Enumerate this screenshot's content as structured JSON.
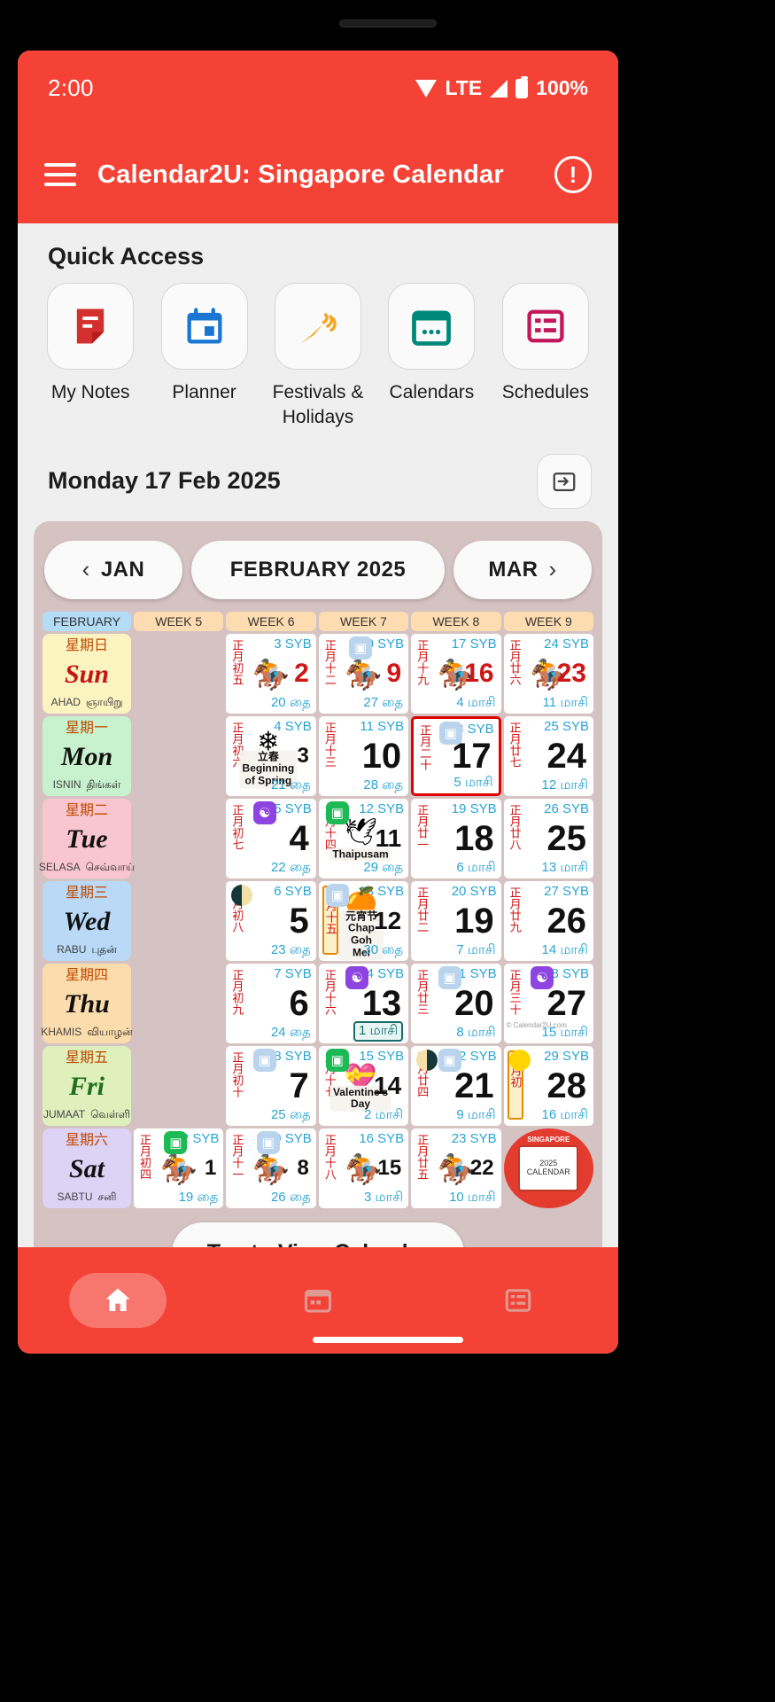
{
  "status": {
    "time": "2:00",
    "network": "LTE",
    "battery": "100%",
    "wifi_icon": "wifi-icon",
    "signal_icon": "signal-icon",
    "battery_icon": "battery-icon"
  },
  "appbar": {
    "menu_icon": "hamburger-menu-icon",
    "title": "Calendar2U: Singapore Calendar",
    "info_icon": "info-icon",
    "info_glyph": "!"
  },
  "quick_access": {
    "title": "Quick Access",
    "items": [
      {
        "label": "My Notes",
        "icon": "notes-icon",
        "glyph": "📝",
        "color": "#d32f2f"
      },
      {
        "label": "Planner",
        "icon": "planner-calendar-icon",
        "glyph": "📅",
        "color": "#1976d2"
      },
      {
        "label": "Festivals & Holidays",
        "icon": "party-popper-icon",
        "glyph": "🎉",
        "color": "#f5a623"
      },
      {
        "label": "Calendars",
        "icon": "calendars-icon",
        "glyph": "🗓",
        "color": "#00897b"
      },
      {
        "label": "Schedules",
        "icon": "schedules-list-icon",
        "glyph": "📋",
        "color": "#c2185b"
      }
    ]
  },
  "dateline": {
    "text": "Monday 17 Feb 2025",
    "jump_icon": "jump-to-date-icon"
  },
  "month_nav": {
    "prev_label": "JAN",
    "prev_icon": "chevron-left-icon",
    "current_label": "FEBRUARY 2025",
    "next_label": "MAR",
    "next_icon": "chevron-right-icon"
  },
  "week_headers": [
    "FEBRUARY",
    "WEEK 5",
    "WEEK 6",
    "WEEK 7",
    "WEEK 8",
    "WEEK 9"
  ],
  "day_rows": [
    {
      "cn": "星期日",
      "en": "Sun",
      "ms": "AHAD",
      "ta": "ஞாயிறு",
      "bg": "#fbf3c0",
      "color": "#c41414"
    },
    {
      "cn": "星期一",
      "en": "Mon",
      "ms": "ISNIN",
      "ta": "திங்கள்",
      "bg": "#c7f2cd",
      "color": "#111111"
    },
    {
      "cn": "星期二",
      "en": "Tue",
      "ms": "SELASA",
      "ta": "செவ்வாய்",
      "bg": "#f9c5d1",
      "color": "#111111"
    },
    {
      "cn": "星期三",
      "en": "Wed",
      "ms": "RABU",
      "ta": "புதன்",
      "bg": "#b9d9f7",
      "color": "#111111"
    },
    {
      "cn": "星期四",
      "en": "Thu",
      "ms": "KHAMIS",
      "ta": "வியாழன்",
      "bg": "#fbdcac",
      "color": "#111111"
    },
    {
      "cn": "星期五",
      "en": "Fri",
      "ms": "JUMAAT",
      "ta": "வெள்ளி",
      "bg": "#dff0bd",
      "color": "#1e6f1e"
    },
    {
      "cn": "星期六",
      "en": "Sat",
      "ms": "SABTU",
      "ta": "சனி",
      "bg": "#ddd3f5",
      "color": "#111111"
    }
  ],
  "cells": {
    "sun": [
      {
        "empty": true
      },
      {
        "syb": "3 SYB",
        "lunar": "正月初五",
        "num": "2",
        "tamil": "20 தை",
        "emoji": "🏇",
        "style": "sun"
      },
      {
        "syb": "10 SYB",
        "lunar": "正月十二",
        "num": "9",
        "tamil": "27 தை",
        "emoji": "🏇",
        "style": "sun",
        "badge": "blue"
      },
      {
        "syb": "17 SYB",
        "lunar": "正月十九",
        "num": "16",
        "tamil": "4 மாசி",
        "emoji": "🏇",
        "style": "sun"
      },
      {
        "syb": "24 SYB",
        "lunar": "正月廿六",
        "num": "23",
        "tamil": "11 மாசி",
        "emoji": "🏇",
        "style": "sun"
      }
    ],
    "mon": [
      {
        "empty": true
      },
      {
        "syb": "4 SYB",
        "lunar": "正月初六",
        "num": "3",
        "tamil": "21 தை",
        "event_emoji": "❄",
        "event_label": "立春\nBeginning of Spring",
        "style": "small"
      },
      {
        "syb": "11 SYB",
        "lunar": "正月十三",
        "num": "10",
        "tamil": "28 தை",
        "style": "big"
      },
      {
        "syb": "18 SYB",
        "lunar": "正月二十",
        "num": "17",
        "tamil": "5 மாசி",
        "style": "big",
        "today": true,
        "badge": "blue"
      },
      {
        "syb": "25 SYB",
        "lunar": "正月廿七",
        "num": "24",
        "tamil": "12 மாசி",
        "style": "big"
      }
    ],
    "tue": [
      {
        "empty": true
      },
      {
        "syb": "5 SYB",
        "lunar": "正月初七",
        "num": "4",
        "tamil": "22 தை",
        "style": "big",
        "badge": "purple"
      },
      {
        "syb": "12 SYB",
        "lunar": "正月十四",
        "num": "11",
        "tamil": "29 தை",
        "event_emoji": "🕊",
        "event_label": "Thaipusam",
        "style": "mid",
        "badge": "green"
      },
      {
        "syb": "19 SYB",
        "lunar": "正月廿一",
        "num": "18",
        "tamil": "6 மாசி",
        "style": "big"
      },
      {
        "syb": "26 SYB",
        "lunar": "正月廿八",
        "num": "25",
        "tamil": "13 மாசி",
        "style": "big"
      }
    ],
    "wed": [
      {
        "empty": true
      },
      {
        "syb": "6 SYB",
        "lunar": "正月初八",
        "num": "5",
        "tamil": "23 தை",
        "style": "big",
        "moon": "dark"
      },
      {
        "syb": "13 SYB",
        "lunar": "正月十五",
        "lunar_boxed": true,
        "num": "12",
        "tamil": "30 தை",
        "event_emoji": "🍊",
        "event_label": "元宵节 Chap Goh Mei",
        "style": "mid",
        "badge": "blue"
      },
      {
        "syb": "20 SYB",
        "lunar": "正月廿二",
        "num": "19",
        "tamil": "7 மாசி",
        "style": "big"
      },
      {
        "syb": "27 SYB",
        "lunar": "正月廿九",
        "num": "26",
        "tamil": "14 மாசி",
        "style": "big"
      }
    ],
    "thu": [
      {
        "empty": true
      },
      {
        "syb": "7 SYB",
        "lunar": "正月初九",
        "num": "6",
        "tamil": "24 தை",
        "style": "big"
      },
      {
        "syb": "14 SYB",
        "lunar": "正月十六",
        "num": "13",
        "tamil": "1 மாசி",
        "tamil_boxed": true,
        "style": "big",
        "badge": "purple"
      },
      {
        "syb": "21 SYB",
        "lunar": "正月廿三",
        "num": "20",
        "tamil": "8 மாசி",
        "style": "big",
        "badge": "blue"
      },
      {
        "syb": "28 SYB",
        "lunar": "正月三十",
        "num": "27",
        "tamil": "15 மாசி",
        "style": "big",
        "badge": "purple",
        "watermark": "© Calendar2U.com"
      }
    ],
    "fri": [
      {
        "empty": true
      },
      {
        "syb": "8 SYB",
        "lunar": "正月初十",
        "num": "7",
        "tamil": "25 தை",
        "style": "big",
        "badge": "blue"
      },
      {
        "syb": "15 SYB",
        "lunar": "正月十七",
        "num": "14",
        "tamil": "2 மாசி",
        "event_emoji": "💝",
        "event_label": "Valentine's Day",
        "style": "mid",
        "badge": "green"
      },
      {
        "syb": "22 SYB",
        "lunar": "正月廿四",
        "num": "21",
        "tamil": "9 மாசி",
        "style": "big",
        "moon": "darkr",
        "badge": "blue"
      },
      {
        "syb": "29 SYB",
        "lunar": "正月初",
        "lunar_boxed": true,
        "num": "28",
        "tamil": "16 மாசி",
        "style": "big",
        "moon": "full"
      }
    ],
    "sat": [
      {
        "syb": "2 SYB",
        "lunar": "正月初四",
        "num": "1",
        "tamil": "19 தை",
        "emoji": "🏇",
        "style": "small",
        "badge": "green"
      },
      {
        "syb": "9 SYB",
        "lunar": "正月十一",
        "num": "8",
        "tamil": "26 தை",
        "emoji": "🏇",
        "style": "small",
        "badge": "blue"
      },
      {
        "syb": "16 SYB",
        "lunar": "正月十八",
        "num": "15",
        "tamil": "3 மாசி",
        "emoji": "🏇",
        "style": "small"
      },
      {
        "syb": "23 SYB",
        "lunar": "正月廿五",
        "num": "22",
        "tamil": "10 மாசி",
        "emoji": "🏇",
        "style": "small"
      },
      {
        "singapore_badge": true,
        "sg_label": "SINGAPORE",
        "sg_inner": "2025 CALENDAR"
      }
    ]
  },
  "tap_button": {
    "label": "Tap to View Calendar"
  },
  "bottom_nav": [
    {
      "name": "home",
      "icon": "home-icon",
      "glyph": "🏠",
      "active": true
    },
    {
      "name": "calendar",
      "icon": "calendar-icon",
      "glyph": "🗓",
      "active": false
    },
    {
      "name": "list",
      "icon": "list-icon",
      "glyph": "📋",
      "active": false
    }
  ],
  "colors": {
    "brand_red": "#f44336",
    "card_bg": "#d5c2c2",
    "today_border": "#e00000",
    "syb_blue": "#29a4d4",
    "lunar_red": "#d01515"
  }
}
